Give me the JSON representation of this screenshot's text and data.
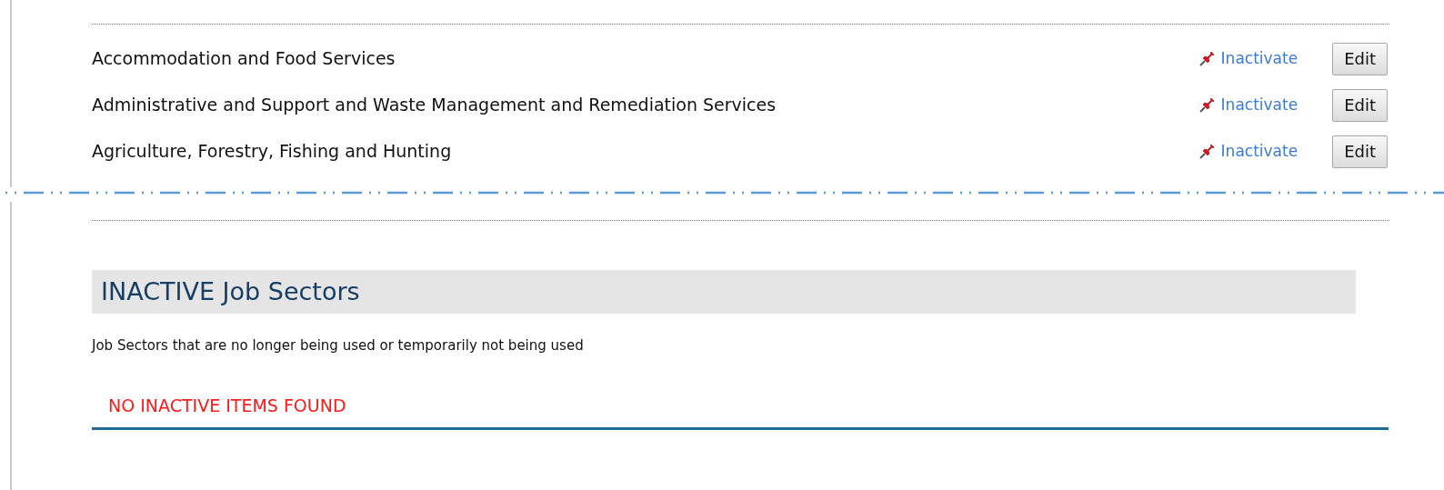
{
  "active_sectors": [
    {
      "name": "Accommodation and Food Services",
      "action": "Inactivate",
      "edit": "Edit"
    },
    {
      "name": "Administrative and Support and Waste Management and Remediation Services",
      "action": "Inactivate",
      "edit": "Edit"
    },
    {
      "name": "Agriculture, Forestry, Fishing and Hunting",
      "action": "Inactivate",
      "edit": "Edit"
    }
  ],
  "inactive_section": {
    "title": "INACTIVE Job Sectors",
    "description": "Job Sectors that are no longer being used or temporarily not being used",
    "empty_message": "NO INACTIVE ITEMS FOUND"
  }
}
